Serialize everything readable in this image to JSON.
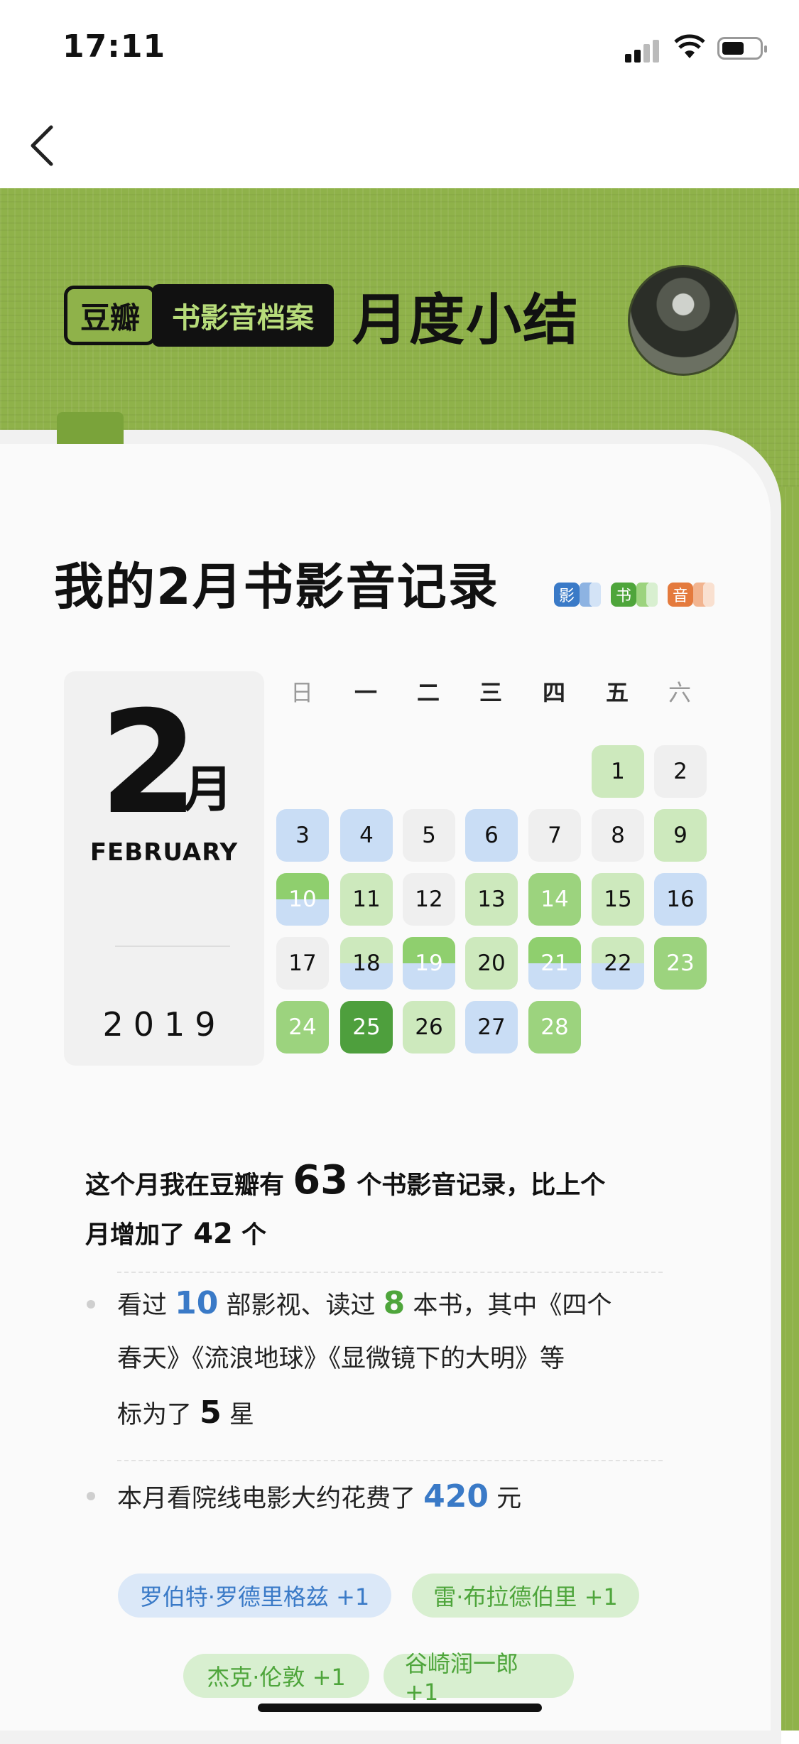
{
  "status_bar": {
    "time": "17:11"
  },
  "header": {
    "logo_douban": "豆瓣",
    "logo_archive": "书影音档案",
    "logo_title": "月度小结"
  },
  "card": {
    "title": "我的2月书影音记录",
    "legend": [
      {
        "label": "影",
        "color": "#3a7ac7"
      },
      {
        "label": "书",
        "color": "#4ea53b"
      },
      {
        "label": "音",
        "color": "#e47a3d"
      }
    ]
  },
  "date": {
    "day_big": "2",
    "month_cn": "月",
    "month_en": "FEBRUARY",
    "year": "2019"
  },
  "calendar": {
    "weekdays": [
      "日",
      "一",
      "二",
      "三",
      "四",
      "五",
      "六"
    ],
    "days": [
      {
        "d": "1",
        "s": "lg"
      },
      {
        "d": "2",
        "s": "gray"
      },
      {
        "d": "3",
        "s": "blue"
      },
      {
        "d": "4",
        "s": "blue"
      },
      {
        "d": "5",
        "s": "gray"
      },
      {
        "d": "6",
        "s": "blue"
      },
      {
        "d": "7",
        "s": "gray"
      },
      {
        "d": "8",
        "s": "gray"
      },
      {
        "d": "9",
        "s": "lg"
      },
      {
        "d": "10",
        "s": "split"
      },
      {
        "d": "11",
        "s": "lg"
      },
      {
        "d": "12",
        "s": "gray"
      },
      {
        "d": "13",
        "s": "lg"
      },
      {
        "d": "14",
        "s": "mg"
      },
      {
        "d": "15",
        "s": "lg"
      },
      {
        "d": "16",
        "s": "blue"
      },
      {
        "d": "17",
        "s": "gray"
      },
      {
        "d": "18",
        "s": "split-lg"
      },
      {
        "d": "19",
        "s": "split"
      },
      {
        "d": "20",
        "s": "lg"
      },
      {
        "d": "21",
        "s": "split"
      },
      {
        "d": "22",
        "s": "split-lg"
      },
      {
        "d": "23",
        "s": "mg"
      },
      {
        "d": "24",
        "s": "mg"
      },
      {
        "d": "25",
        "s": "dg"
      },
      {
        "d": "26",
        "s": "lg"
      },
      {
        "d": "27",
        "s": "blue"
      },
      {
        "d": "28",
        "s": "mg"
      }
    ]
  },
  "summary": {
    "line1_a": "这个月我在豆瓣有 ",
    "count": "63",
    "line1_b": " 个书影音记录，比上个",
    "line2_a": "月增加了 ",
    "increase": "42",
    "line2_b": " 个"
  },
  "item1": {
    "a": "看过 ",
    "movies": "10",
    "b": " 部影视、读过 ",
    "books": "8",
    "c": " 本书，其中《四个",
    "line2": "春天》《流浪地球》《显微镜下的大明》等",
    "line3_a": "标为了 ",
    "stars": "5",
    "line3_b": " 星"
  },
  "item2": {
    "a": "本月看院线电影大约花费了 ",
    "amount": "420",
    "b": " 元"
  },
  "tags": [
    {
      "label": "罗伯特·罗德里格兹 +1",
      "color": "blue"
    },
    {
      "label": "雷·布拉德伯里 +1",
      "color": "green"
    },
    {
      "label": "杰克·伦敦 +1",
      "color": "green"
    },
    {
      "label": "谷崎润一郎 +1",
      "color": "green"
    }
  ]
}
